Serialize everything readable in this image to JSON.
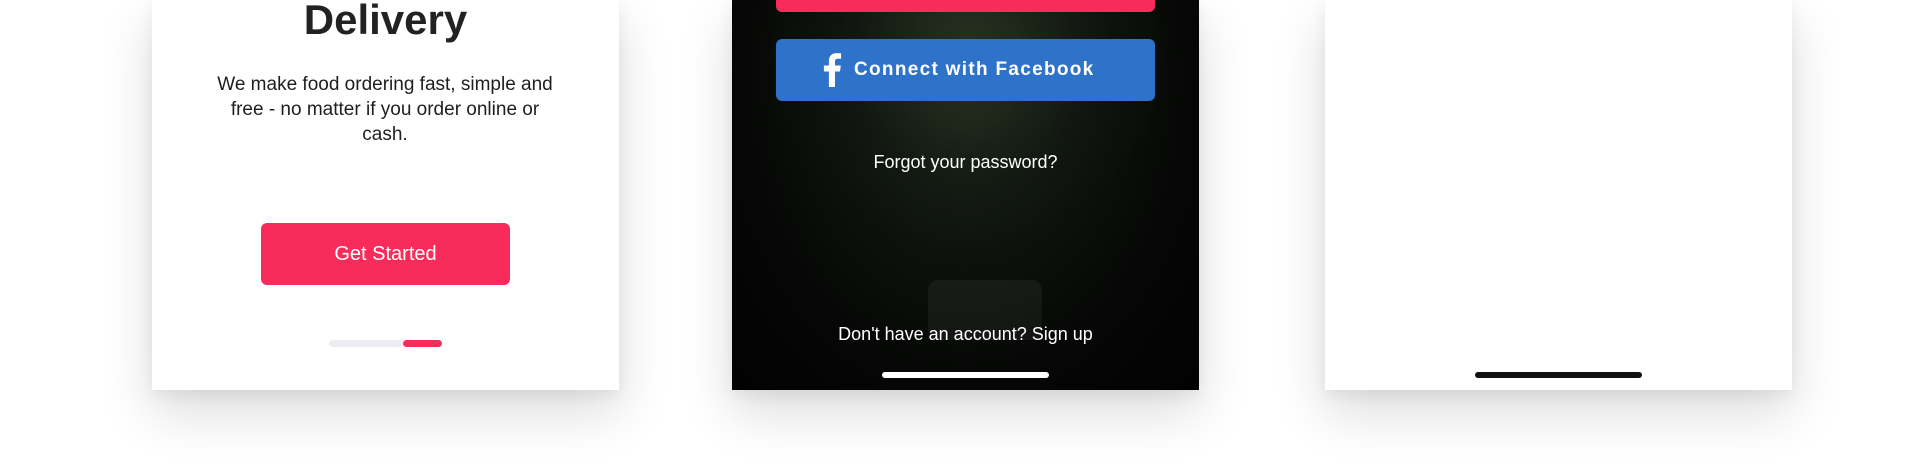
{
  "colors": {
    "accent": "#f72c5b",
    "facebook": "#2e72ca",
    "title_text": "#222222",
    "dark_bg": "#050605"
  },
  "onboarding": {
    "title": "Delivery",
    "description": "We make food ordering fast, simple and free - no matter if you order online or cash.",
    "cta_label": "Get Started",
    "pager": {
      "total": 2,
      "active_index": 1
    }
  },
  "login": {
    "facebook_icon": "facebook-f-icon",
    "facebook_label": "Connect with Facebook",
    "forgot_password": "Forgot your password?",
    "signup_prompt": "Don't have an account?",
    "signup_link": "Sign up"
  }
}
